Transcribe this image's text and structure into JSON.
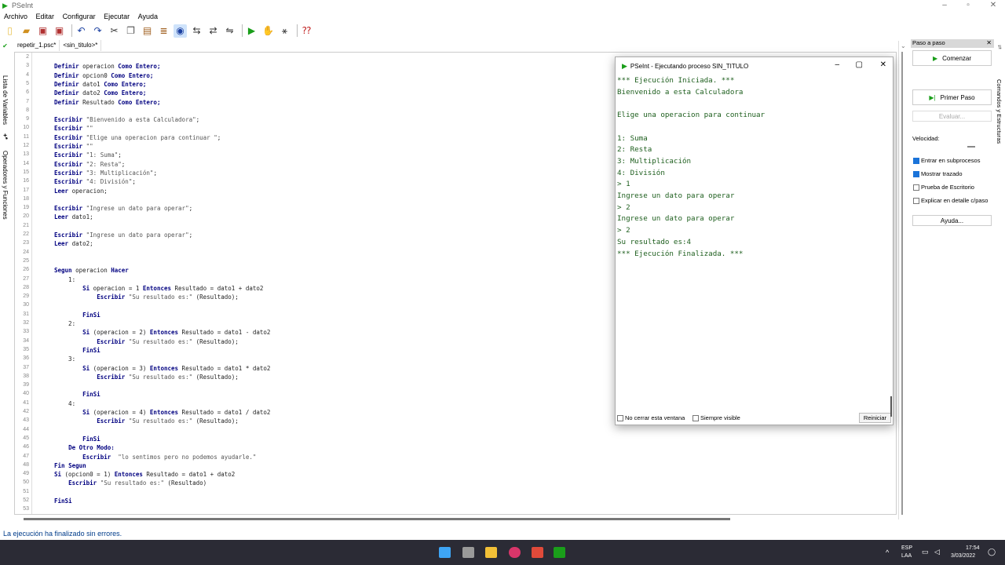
{
  "window": {
    "title": "PSeInt"
  },
  "menu": [
    "Archivo",
    "Editar",
    "Configurar",
    "Ejecutar",
    "Ayuda"
  ],
  "tabs": [
    "repetir_1.psc*",
    "<sin_titulo>*"
  ],
  "left_panel": {
    "variables": "Lista de Variables",
    "operators": "Operadores y Funciones"
  },
  "code_lines": [
    {
      "n": "2",
      "c": ""
    },
    {
      "n": "3",
      "c": "Definir operacion Como Entero;"
    },
    {
      "n": "4",
      "c": "Definir opcion0 Como Entero;"
    },
    {
      "n": "5",
      "c": "Definir dato1 Como Entero;"
    },
    {
      "n": "6",
      "c": "Definir dato2 Como Entero;"
    },
    {
      "n": "7",
      "c": "Definir Resultado Como Entero;"
    },
    {
      "n": "8",
      "c": ""
    },
    {
      "n": "9",
      "c": "Escribir \"Bienvenido a esta Calculadora\";"
    },
    {
      "n": "10",
      "c": "Escribir \"\""
    },
    {
      "n": "11",
      "c": "Escribir \"Elige una operacion para continuar \";"
    },
    {
      "n": "12",
      "c": "Escribir \"\""
    },
    {
      "n": "13",
      "c": "Escribir \"1: Suma\";"
    },
    {
      "n": "14",
      "c": "Escribir \"2: Resta\";"
    },
    {
      "n": "15",
      "c": "Escribir \"3: Multiplicación\";"
    },
    {
      "n": "16",
      "c": "Escribir \"4: División\";"
    },
    {
      "n": "17",
      "c": "Leer operacion;"
    },
    {
      "n": "18",
      "c": ""
    },
    {
      "n": "19",
      "c": "Escribir \"Ingrese un dato para operar\";"
    },
    {
      "n": "20",
      "c": "Leer dato1;"
    },
    {
      "n": "21",
      "c": ""
    },
    {
      "n": "22",
      "c": "Escribir \"Ingrese un dato para operar\";"
    },
    {
      "n": "23",
      "c": "Leer dato2;"
    },
    {
      "n": "24",
      "c": ""
    },
    {
      "n": "25",
      "c": ""
    },
    {
      "n": "26",
      "c": "Segun operacion Hacer"
    },
    {
      "n": "27",
      "c": "    1:"
    },
    {
      "n": "28",
      "c": "        Si operacion = 1 Entonces Resultado = dato1 + dato2"
    },
    {
      "n": "29",
      "c": "            Escribir \"Su resultado es:\" (Resultado);"
    },
    {
      "n": "30",
      "c": ""
    },
    {
      "n": "31",
      "c": "        FinSi"
    },
    {
      "n": "32",
      "c": "    2:"
    },
    {
      "n": "33",
      "c": "        Si (operacion = 2) Entonces Resultado = dato1 - dato2"
    },
    {
      "n": "34",
      "c": "            Escribir \"Su resultado es:\" (Resultado);"
    },
    {
      "n": "35",
      "c": "        FinSi"
    },
    {
      "n": "36",
      "c": "    3:"
    },
    {
      "n": "37",
      "c": "        Si (operacion = 3) Entonces Resultado = dato1 * dato2"
    },
    {
      "n": "38",
      "c": "            Escribir \"Su resultado es:\" (Resultado);"
    },
    {
      "n": "39",
      "c": ""
    },
    {
      "n": "40",
      "c": "        FinSi"
    },
    {
      "n": "41",
      "c": "    4:"
    },
    {
      "n": "42",
      "c": "        Si (operacion = 4) Entonces Resultado = dato1 / dato2"
    },
    {
      "n": "43",
      "c": "            Escribir \"Su resultado es:\" (Resultado);"
    },
    {
      "n": "44",
      "c": ""
    },
    {
      "n": "45",
      "c": "        FinSi"
    },
    {
      "n": "46",
      "c": "    De Otro Modo:"
    },
    {
      "n": "47",
      "c": "        Escribir  \"lo sentimos pero no podemos ayudarle.\""
    },
    {
      "n": "48",
      "c": "Fin Segun"
    },
    {
      "n": "49",
      "c": "Si (opcion0 = 1) Entonces Resultado = dato1 + dato2"
    },
    {
      "n": "50",
      "c": "    Escribir \"Su resultado es:\" (Resultado)"
    },
    {
      "n": "51",
      "c": ""
    },
    {
      "n": "52",
      "c": "FinSi"
    },
    {
      "n": "53",
      "c": ""
    }
  ],
  "console": {
    "title": "PSeInt - Ejecutando proceso SIN_TITULO",
    "lines": [
      "*** Ejecución Iniciada. ***",
      "Bienvenido a esta Calculadora",
      "",
      "Elige una operacion para continuar",
      "",
      "1: Suma",
      "2: Resta",
      "3: Multiplicación",
      "4: División",
      "> 1",
      "Ingrese un dato para operar",
      "> 2",
      "Ingrese un dato para operar",
      "> 2",
      "Su resultado es:4",
      "*** Ejecución Finalizada. ***"
    ],
    "no_cerrar": "No cerrar esta ventana",
    "siempre_visible": "Siempre visible",
    "reiniciar": "Reiniciar"
  },
  "right_panel": {
    "header": "Paso a paso",
    "comenzar": "Comenzar",
    "primer_paso": "Primer Paso",
    "evaluar": "Evaluar...",
    "velocidad": "Velocidad:",
    "subprocesos": "Entrar en subprocesos",
    "mostrar_trazado": "Mostrar trazado",
    "prueba_escritorio": "Prueba de Escritorio",
    "explicar": "Explicar en detalle c/paso",
    "ayuda": "Ayuda...",
    "vertical": "Comandos y Estructuras"
  },
  "status": "La ejecución ha finalizado sin errores.",
  "tray": {
    "lang1": "ESP",
    "lang2": "LAA",
    "time": "17:54",
    "date": "3/03/2022"
  },
  "keywords": [
    "Definir",
    "Como",
    "Entero",
    "Escribir",
    "Leer",
    "Segun",
    "Hacer",
    "Si",
    "Entonces",
    "FinSi",
    "De",
    "Otro",
    "Modo",
    "Fin"
  ]
}
